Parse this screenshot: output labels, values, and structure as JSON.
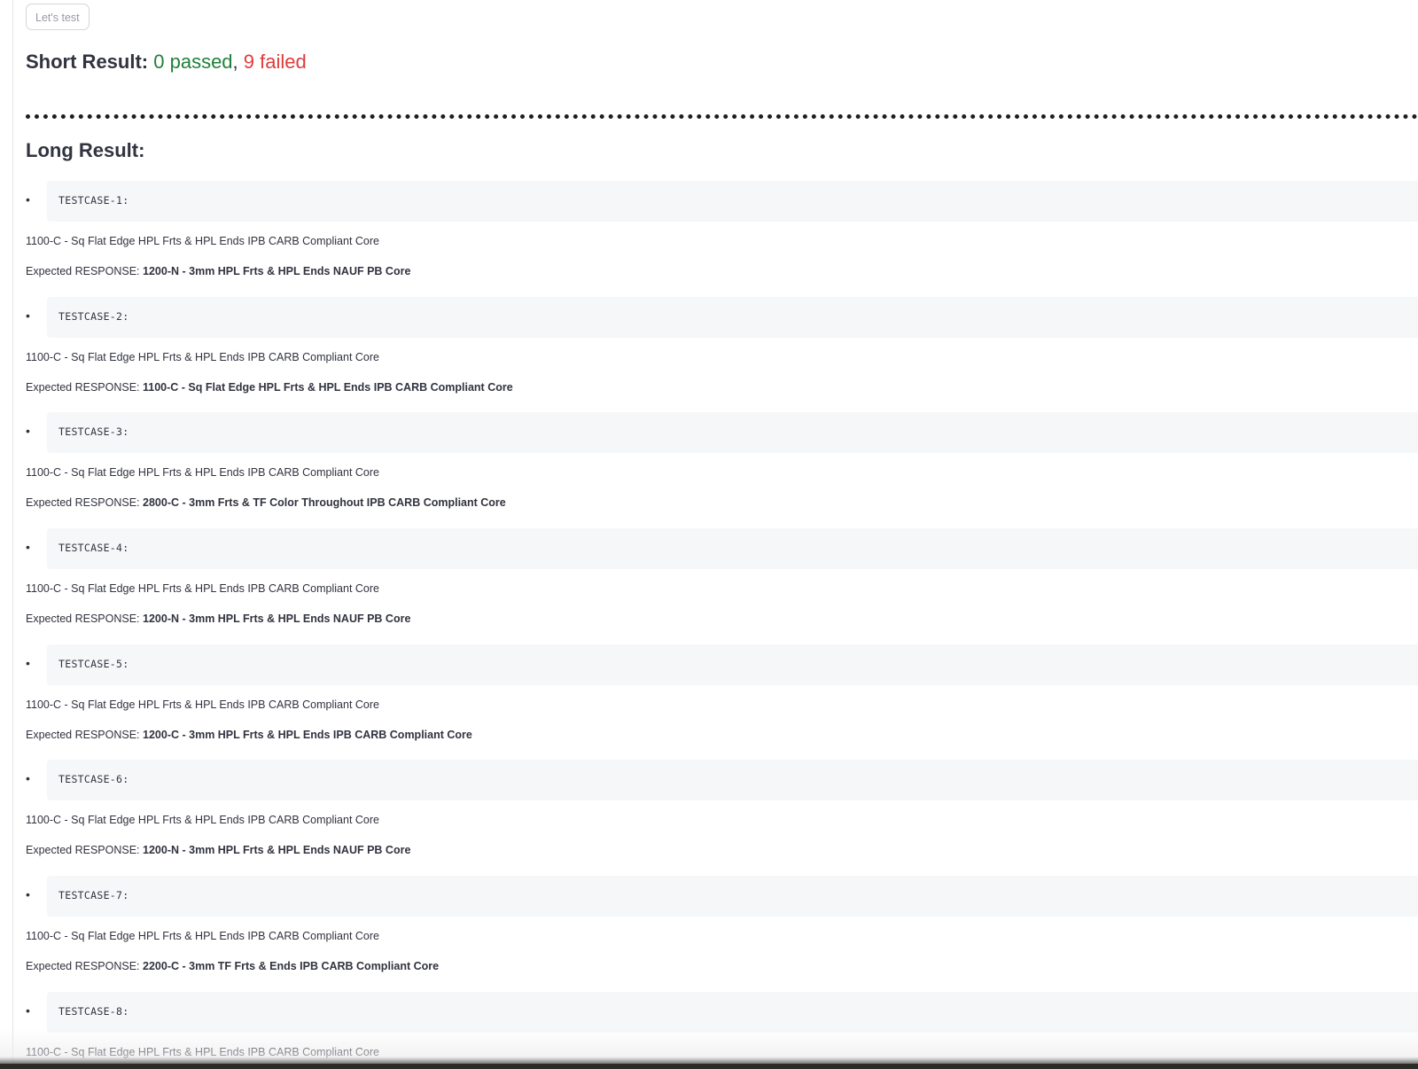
{
  "toolbar": {
    "test_button_label": "Let's test"
  },
  "short_result": {
    "label": "Short Result:",
    "passed_text": "0 passed",
    "separator": ",",
    "failed_text": "9 failed",
    "colors": {
      "passed": "#21803a",
      "failed": "#e03b3b"
    }
  },
  "long_result": {
    "label": "Long Result:"
  },
  "expected_prefix": "Expected RESPONSE:",
  "bullet_glyph": "•",
  "testcases": [
    {
      "name": "TESTCASE-1:",
      "response": "1100-C - Sq Flat Edge HPL Frts & HPL Ends IPB CARB Compliant Core",
      "expected": "1200-N - 3mm HPL Frts & HPL Ends NAUF PB Core"
    },
    {
      "name": "TESTCASE-2:",
      "response": "1100-C - Sq Flat Edge HPL Frts & HPL Ends IPB CARB Compliant Core",
      "expected": "1100-C - Sq Flat Edge HPL Frts & HPL Ends IPB CARB Compliant Core"
    },
    {
      "name": "TESTCASE-3:",
      "response": "1100-C - Sq Flat Edge HPL Frts & HPL Ends IPB CARB Compliant Core",
      "expected": "2800-C - 3mm Frts & TF Color Throughout IPB CARB Compliant Core"
    },
    {
      "name": "TESTCASE-4:",
      "response": "1100-C - Sq Flat Edge HPL Frts & HPL Ends IPB CARB Compliant Core",
      "expected": "1200-N - 3mm HPL Frts & HPL Ends NAUF PB Core"
    },
    {
      "name": "TESTCASE-5:",
      "response": "1100-C - Sq Flat Edge HPL Frts & HPL Ends IPB CARB Compliant Core",
      "expected": "1200-C - 3mm HPL Frts & HPL Ends IPB CARB Compliant Core"
    },
    {
      "name": "TESTCASE-6:",
      "response": "1100-C - Sq Flat Edge HPL Frts & HPL Ends IPB CARB Compliant Core",
      "expected": "1200-N - 3mm HPL Frts & HPL Ends NAUF PB Core"
    },
    {
      "name": "TESTCASE-7:",
      "response": "1100-C - Sq Flat Edge HPL Frts & HPL Ends IPB CARB Compliant Core",
      "expected": "2200-C - 3mm TF Frts & Ends IPB CARB Compliant Core"
    },
    {
      "name": "TESTCASE-8:",
      "response": "1100-C - Sq Flat Edge HPL Frts & HPL Ends IPB CARB Compliant Core",
      "expected": ""
    }
  ]
}
